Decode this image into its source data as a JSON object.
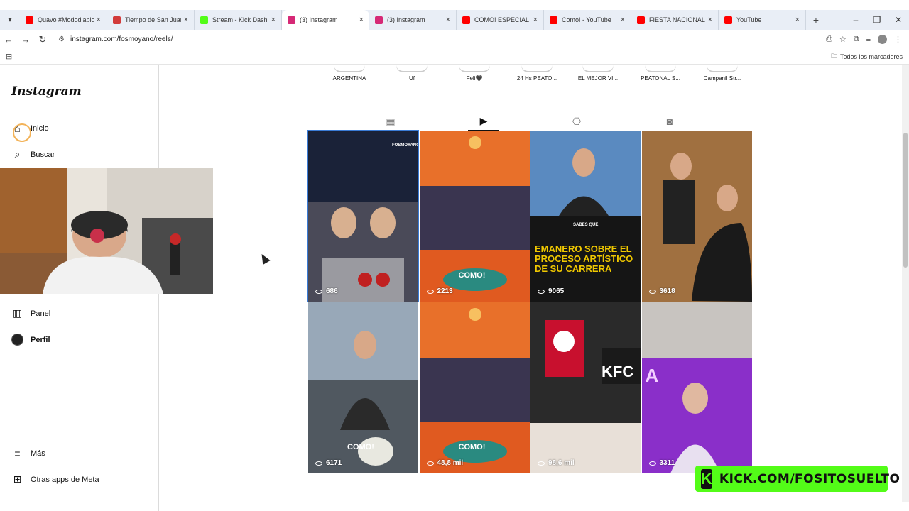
{
  "browser": {
    "tabs": [
      {
        "label": "Quavo #Mododiablo",
        "favicon_color": "#ff0000"
      },
      {
        "label": "Tiempo de San Juan",
        "favicon_color": "#d23b3b"
      },
      {
        "label": "Stream - Kick Dashbo",
        "favicon_color": "#53fc18"
      },
      {
        "label": "(3) Instagram",
        "favicon_color": "#d62976"
      },
      {
        "label": "(3) Instagram",
        "favicon_color": "#d62976"
      },
      {
        "label": "COMO! ESPECIAL FIE",
        "favicon_color": "#ff0000"
      },
      {
        "label": "Como! - YouTube",
        "favicon_color": "#ff0000"
      },
      {
        "label": "FIESTA NACIONAL DI",
        "favicon_color": "#ff0000"
      },
      {
        "label": "YouTube",
        "favicon_color": "#ff0000"
      }
    ],
    "active_tab_index": 3,
    "url": "instagram.com/fosmoyano/reels/",
    "bookmarks_label": "Todos los marcadores"
  },
  "sidebar": {
    "logo": "Instagram",
    "items_top": [
      {
        "label": "Inicio",
        "icon": "home-icon"
      },
      {
        "label": "Buscar",
        "icon": "search-icon"
      }
    ],
    "items_bottom": [
      {
        "label": "Panel",
        "icon": "chart-icon"
      },
      {
        "label": "Perfil",
        "icon": "profile-icon"
      }
    ],
    "footer": [
      {
        "label": "Más",
        "icon": "menu-icon"
      },
      {
        "label": "Otras apps de Meta",
        "icon": "meta-apps-icon"
      }
    ]
  },
  "highlights": [
    "ARGENTINA",
    "Uf",
    "Feli🖤",
    "24 Hs PEATO...",
    "EL MEJOR VI...",
    "PEATONAL S...",
    "Campanil Str..."
  ],
  "profile_tabs": [
    {
      "name": "posts",
      "icon": "grid-icon"
    },
    {
      "name": "reels",
      "icon": "reels-icon"
    },
    {
      "name": "saved",
      "icon": "bookmark-icon"
    },
    {
      "name": "tagged",
      "icon": "tagged-icon"
    }
  ],
  "active_profile_tab": "reels",
  "reels": [
    {
      "views": "686",
      "bg": "#2a3040",
      "text": "FOSMOYANO"
    },
    {
      "views": "2213",
      "bg": "#e8702a",
      "text": "COMO!"
    },
    {
      "views": "9065",
      "bg": "#1a1a1a",
      "text": "EMANERO SOBRE EL PROCESO ARTÍSTICO DE SU CARRERA",
      "subtext": "SABES QUE"
    },
    {
      "views": "3618",
      "bg": "#8a6a45",
      "text": ""
    },
    {
      "views": "6171",
      "bg": "#6a7f95",
      "text": "COMO!"
    },
    {
      "views": "48,8 mil",
      "bg": "#e8702a",
      "text": "COMO!"
    },
    {
      "views": "98,6 mil",
      "bg": "#2a2a2a",
      "text": "KFC"
    },
    {
      "views": "3311",
      "bg": "#8a2fc9",
      "text": "A"
    }
  ],
  "overlay": {
    "kick_text": "KICK.COM/FOSITOSUELTO"
  }
}
